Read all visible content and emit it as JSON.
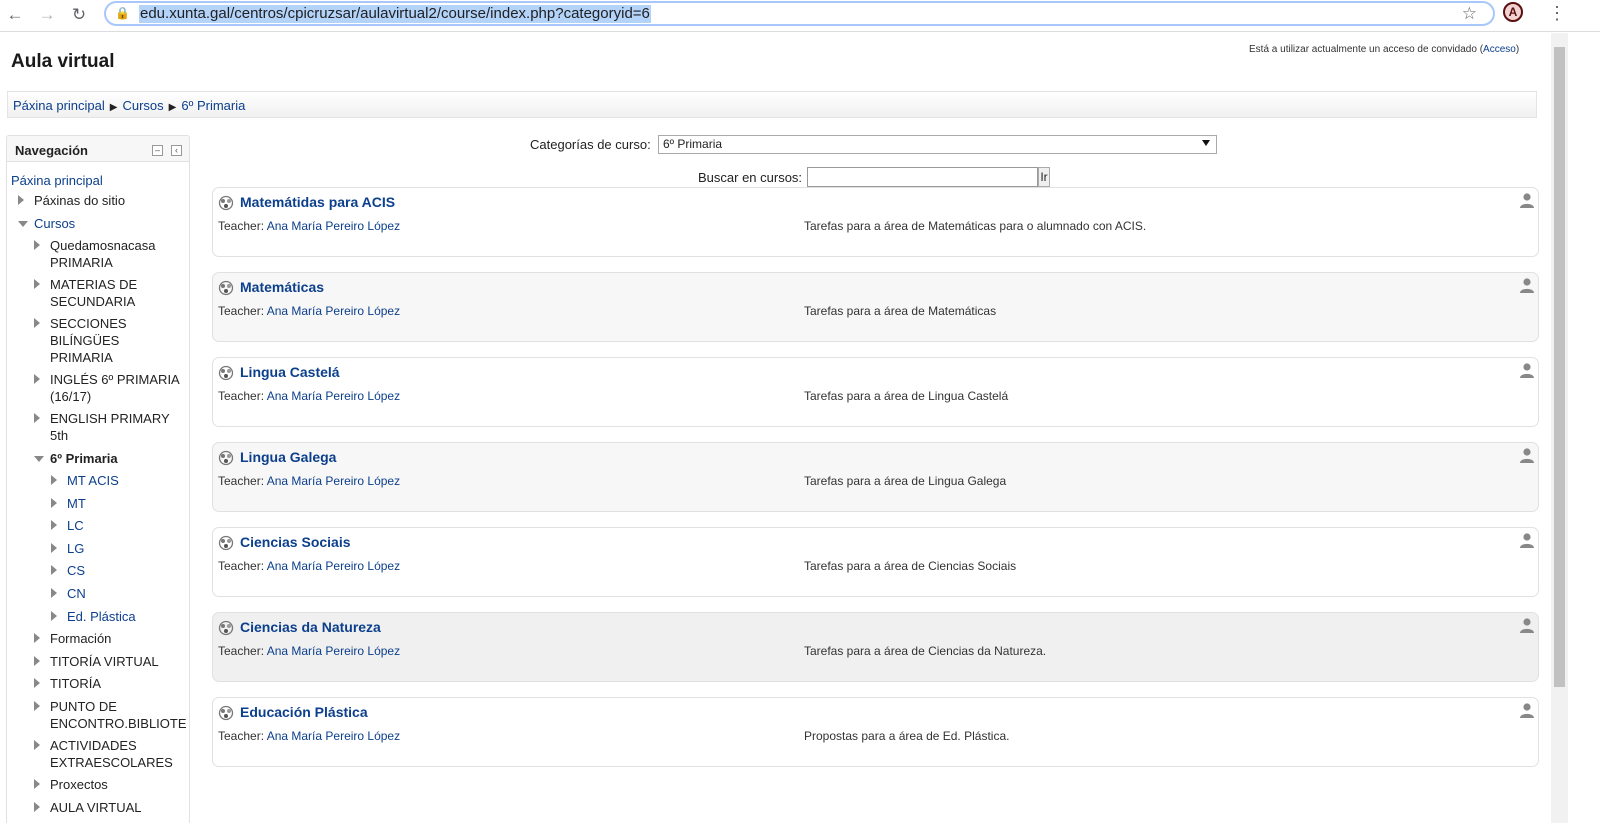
{
  "browser": {
    "url": "edu.xunta.gal/centros/cpicruzsar/aulavirtual2/course/index.php?categoryid=6",
    "profile_initial": "A"
  },
  "header": {
    "site_title": "Aula virtual",
    "login_text": "Está a utilizar actualmente un acceso de convidado (",
    "login_link": "Acceso",
    "login_close": ")"
  },
  "breadcrumb": [
    "Páxina principal",
    "Cursos",
    "6º Primaria"
  ],
  "navigation": {
    "title": "Navegación",
    "items": [
      {
        "label": "Páxina principal",
        "expander": "none",
        "link": true,
        "bold": false
      },
      {
        "label": "Páxinas do sitio",
        "expander": "collapsed",
        "link": false,
        "bold": false
      },
      {
        "label": "Cursos",
        "expander": "expanded",
        "link": true,
        "bold": false
      },
      {
        "label": "Quedamosnacasa",
        "label2": "PRIMARIA",
        "expander": "collapsed",
        "link": false,
        "bold": false
      },
      {
        "label": "MATERIAS DE",
        "label2": "SECUNDARIA",
        "expander": "collapsed",
        "link": false,
        "bold": false
      },
      {
        "label": "SECCIONES",
        "label2": "BILÍNGÜES",
        "label3": "PRIMARIA",
        "expander": "collapsed",
        "link": false,
        "bold": false
      },
      {
        "label": "INGLÉS 6º PRIMARIA",
        "label2": "(16/17)",
        "expander": "collapsed",
        "link": false,
        "bold": false
      },
      {
        "label": "ENGLISH PRIMARY",
        "label2": "5th",
        "expander": "collapsed",
        "link": false,
        "bold": false
      },
      {
        "label": "6º Primaria",
        "expander": "expanded",
        "link": false,
        "bold": true
      },
      {
        "label": "MT ACIS",
        "expander": "collapsed",
        "link": true,
        "bold": false
      },
      {
        "label": "MT",
        "expander": "collapsed",
        "link": true,
        "bold": false
      },
      {
        "label": "LC",
        "expander": "collapsed",
        "link": true,
        "bold": false
      },
      {
        "label": "LG",
        "expander": "collapsed",
        "link": true,
        "bold": false
      },
      {
        "label": "CS",
        "expander": "collapsed",
        "link": true,
        "bold": false
      },
      {
        "label": "CN",
        "expander": "collapsed",
        "link": true,
        "bold": false
      },
      {
        "label": "Ed. Plástica",
        "expander": "collapsed",
        "link": true,
        "bold": false
      },
      {
        "label": "Formación",
        "expander": "collapsed",
        "link": false,
        "bold": false
      },
      {
        "label": "TITORÍA VIRTUAL",
        "expander": "collapsed",
        "link": false,
        "bold": false
      },
      {
        "label": "TITORÍA",
        "expander": "collapsed",
        "link": false,
        "bold": false
      },
      {
        "label": "PUNTO DE",
        "label2": "ENCONTRO.BIBLIOTE",
        "expander": "collapsed",
        "link": false,
        "bold": false
      },
      {
        "label": "ACTIVIDADES",
        "label2": "EXTRAESCOLARES",
        "expander": "collapsed",
        "link": false,
        "bold": false
      },
      {
        "label": "Proxectos",
        "expander": "collapsed",
        "link": false,
        "bold": false
      },
      {
        "label": "AULA VIRTUAL",
        "expander": "collapsed",
        "link": false,
        "bold": false
      }
    ]
  },
  "filters": {
    "category_label": "Categorías de curso:",
    "category_value": "6º Primaria",
    "search_label": "Buscar en cursos:",
    "search_value": "",
    "search_button": "Ir"
  },
  "courses": [
    {
      "name": "Matemátidas para ACIS",
      "teacher_label": "Teacher:",
      "teacher": "Ana María Pereiro López",
      "summary": "Tarefas para a área de Matemáticas para o alumnado con ACIS."
    },
    {
      "name": "Matemáticas",
      "teacher_label": "Teacher:",
      "teacher": "Ana María Pereiro López",
      "summary": "Tarefas para a área de Matemáticas"
    },
    {
      "name": "Lingua Castelá",
      "teacher_label": "Teacher:",
      "teacher": "Ana María Pereiro López",
      "summary": "Tarefas para a área de Lingua Castelá"
    },
    {
      "name": "Lingua Galega",
      "teacher_label": "Teacher:",
      "teacher": "Ana María Pereiro López",
      "summary": "Tarefas para a área de Lingua Galega"
    },
    {
      "name": "Ciencias Sociais",
      "teacher_label": "Teacher:",
      "teacher": "Ana María Pereiro López",
      "summary": "Tarefas para a área de Ciencias Sociais"
    },
    {
      "name": "Ciencias da Natureza",
      "teacher_label": "Teacher:",
      "teacher": "Ana María Pereiro López",
      "summary": "Tarefas para a área de Ciencias da Natureza."
    },
    {
      "name": "Educación Plástica",
      "teacher_label": "Teacher:",
      "teacher": "Ana María Pereiro López",
      "summary": "Propostas para a área de Ed. Plástica."
    }
  ],
  "colors": {
    "link": "#0c3f8c",
    "url_highlight": "#b3d3f8"
  }
}
